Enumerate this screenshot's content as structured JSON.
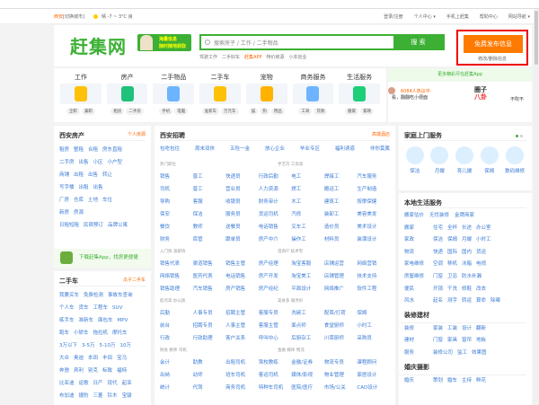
{
  "topbar": {
    "city": "西安",
    "switch": "[切换城市]",
    "weather": "晴  -7 ~ 3°C  良",
    "links": [
      "登录/注册",
      "个人中心 ▾",
      "手机上赶集",
      "帮助中心",
      "网站导航 ▾"
    ]
  },
  "header": {
    "logo": "赶集网",
    "promo": [
      "海量信息",
      "随时随地获取"
    ],
    "search_placeholder": "搜索房子 / 工作 / 二手物品",
    "search_btn": "搜 索",
    "hot": [
      "驾驶工作",
      "二手好车",
      "赶集APP",
      "特价房源",
      "小本创业"
    ],
    "publish": "免费发布信息",
    "edit": "修改/删除信息"
  },
  "categories": [
    {
      "title": "工作",
      "subs": [
        "全职",
        "兼职"
      ],
      "color": "#ffc107"
    },
    {
      "title": "房产",
      "subs": [
        "租房",
        "二手房"
      ],
      "color": "#1ec27a"
    },
    {
      "title": "二手物品",
      "subs": [
        "手机",
        "电脑"
      ],
      "color": "#6cb4ff"
    },
    {
      "title": "二手车",
      "subs": [
        "准新车",
        "万元车"
      ],
      "color": "#ffc107"
    },
    {
      "title": "宠物",
      "subs": [
        "猫",
        "狗",
        "用品"
      ],
      "color": "#ffb300"
    },
    {
      "title": "商务服务",
      "subs": [
        "工商",
        "贷款"
      ],
      "color": "#6cb4ff"
    },
    {
      "title": "生活服务",
      "subs": [
        "搬家",
        "家政"
      ],
      "color": "#1ecf7a"
    }
  ],
  "app": {
    "bar": "更多精彩尽在赶集App",
    "count": "6084人热议中",
    "news": "看，翻翻吃小便面",
    "brand": [
      "圈子",
      "八卦"
    ],
    "more": "不吹不"
  },
  "house": {
    "title": "西安房产",
    "right": "个人房源",
    "rows": [
      [
        "租房",
        "整租",
        "合租",
        "房东直租"
      ],
      [
        "二手房",
        "出售",
        "小区",
        "小户型"
      ],
      [
        "商铺",
        "出租",
        "出售",
        "转让"
      ],
      [
        "写字楼",
        "出租",
        "出售"
      ],
      [
        "厂房",
        "仓库",
        "土地",
        "车位"
      ],
      [
        "新房",
        "房源"
      ],
      [
        "日租短租",
        "民宿预订",
        "品牌公寓"
      ]
    ],
    "download": "下载赶集App，找房更便捷"
  },
  "car": {
    "title": "二手车",
    "right": "瓜子二手车",
    "rows": [
      [
        "我要买车",
        "免费检测",
        "事故车查询"
      ],
      [
        "个人车",
        "货车",
        "工程车",
        "SUV"
      ],
      [
        "练手车",
        "准新车",
        "面包车",
        "MPV"
      ],
      [
        "跑车",
        "小轿车",
        "拖拉机",
        "摩托车"
      ],
      [
        "3万以下",
        "3-5万",
        "5-10万",
        "10万"
      ],
      [
        "大众",
        "奥迪",
        "本田",
        "丰田",
        "宝马"
      ],
      [
        "奔驰",
        "宾利",
        "别克",
        "标致",
        "福特"
      ],
      [
        "比亚迪",
        "讴歌",
        "日产",
        "现代",
        "起亚"
      ],
      [
        "布加迪",
        "捷豹",
        "三菱",
        "铃木",
        "宝骏"
      ]
    ]
  },
  "jobs": {
    "title": "西安招聘",
    "right": "高端酒店",
    "tags": [
      "包吃包住",
      "周末双休",
      "五险一金",
      "放心企业",
      "毕业专区",
      "福利诱惑",
      "非你莫属"
    ],
    "groups": [
      {
        "labels": [
          "热门职位",
          "手艺巧 工资高"
        ],
        "items": [
          "销售",
          "普工",
          "快递员",
          "行政后勤",
          "电工",
          "焊接工",
          "汽车服务",
          "司机",
          "普工",
          "营业员",
          "人力资源",
          "焊工",
          "搬运工",
          "生产制造",
          "导购",
          "客服",
          "收银员",
          "财务审计",
          "木工",
          "建筑工",
          "按摩保健",
          "保安",
          "保洁",
          "服务员",
          "货运司机",
          "汽修",
          "装卸工",
          "美容美发",
          "餐饮",
          "教师",
          "送餐员",
          "电话销售",
          "叉车工",
          "造价员",
          "美术设计",
          "财务",
          "库管",
          "跟单员",
          "房产中介",
          "操作工",
          "材料员",
          "装潢设计"
        ]
      },
      {
        "labels": [
          "入门快 涨薪快",
          "电商IT 技术宅"
        ],
        "items": [
          "销售代表",
          "渠道销售",
          "销售主管",
          "房产经理",
          "淘宝客服",
          "店铺运营",
          "网络营销",
          "网络销售",
          "医药代表",
          "电话销售",
          "房产开发",
          "淘宝美工",
          "店铺管理",
          "技术支持",
          "销售助理",
          "汽车销售",
          "房产销售",
          "房产经纪",
          "平面设计",
          "网络推广",
          "软件工程"
        ]
      },
      {
        "labels": [
          "起点高 办公族",
          "美食多 服务好"
        ],
        "items": [
          "后勤",
          "人事专员",
          "招聘主管",
          "客服专员",
          "洗碗工",
          "配菜/打荷",
          "保姆",
          "前台",
          "招聘专员",
          "人事主管",
          "客服主管",
          "面点师",
          "食堂厨师",
          "小时工",
          "行政",
          "行政助理",
          "客户关系",
          "呼叫中心",
          "后厨杂工",
          "川菜厨师",
          "采购员"
        ]
      },
      {
        "labels": [
          "财会 教师 司机",
          "金融 媒体 物流"
        ],
        "items": [
          "会计",
          "助教",
          "出租司机",
          "驾校教练",
          "金融/证券",
          "物流专员",
          "课程顾问",
          "出纳",
          "幼师",
          "班车司机",
          "客运司机",
          "媒体/影视",
          "物业管理",
          "家居设计",
          "统计",
          "代驾",
          "商务司机",
          "特种车司机",
          "医院/医疗",
          "市场/公关",
          "CAD设计"
        ]
      }
    ]
  },
  "family": {
    "title": "家庭上门服务",
    "items": [
      "保洁",
      "月嫂",
      "育儿嫂",
      "保姆",
      "数码维修"
    ]
  },
  "life": {
    "title": "本地生活服务",
    "top": [
      "搬家估价",
      "无忧装修",
      "金牌商家"
    ],
    "rows": [
      {
        "k": "搬家",
        "v": [
          "住宅",
          "全杯",
          "长途",
          "办公室"
        ]
      },
      {
        "k": "家政",
        "v": [
          "保洁",
          "保姆",
          "月嫂",
          "小时工"
        ]
      },
      {
        "k": "物流",
        "v": [
          "快递",
          "国际",
          "国内",
          "货运"
        ]
      },
      {
        "k": "家电维修",
        "v": [
          "空调",
          "移机",
          "冰箱",
          "电视"
        ]
      },
      {
        "k": "房屋维修",
        "v": [
          "门窗",
          "卫浴",
          "防水补漏"
        ]
      },
      {
        "k": "便民",
        "v": [
          "开锁",
          "干洗",
          "修鞋",
          "改衣"
        ]
      },
      {
        "k": "风水",
        "v": [
          "起名",
          "测字",
          "转运",
          "算命",
          "除霉"
        ]
      }
    ]
  },
  "deco": {
    "title": "装修建材",
    "rows": [
      {
        "k": "装修",
        "v": [
          "家装",
          "工装",
          "设计",
          "翻新"
        ]
      },
      {
        "k": "建材",
        "v": [
          "门窗",
          "家具",
          "窗帘",
          "地板"
        ]
      },
      {
        "k": "服务",
        "v": [
          "装修公司",
          "监工",
          "效果图"
        ]
      }
    ]
  },
  "wedding": {
    "title": "婚庆摄影",
    "rows": [
      {
        "k": "婚庆",
        "v": [
          "策划",
          "婚车",
          "主持",
          "鲜花"
        ]
      }
    ]
  }
}
